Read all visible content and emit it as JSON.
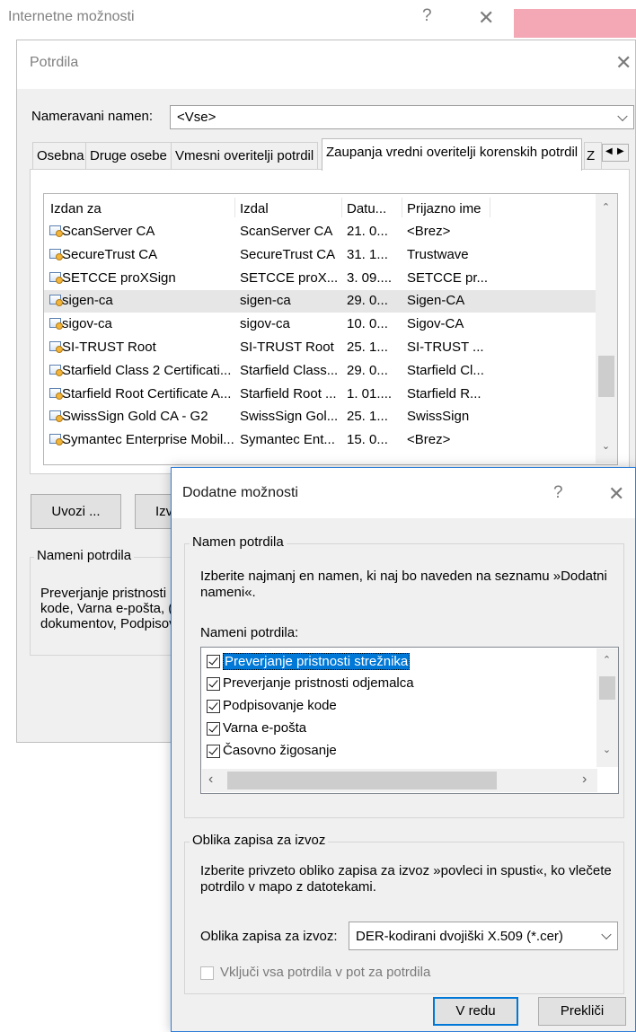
{
  "internet_options": {
    "title": "Internetne možnosti",
    "help": "?",
    "close": "✕"
  },
  "certificates": {
    "title": "Potrdila",
    "close": "✕",
    "intended_purpose_label": "Nameravani namen:",
    "intended_purpose_value": "<Vse>",
    "tabs": [
      {
        "label": "Osebna"
      },
      {
        "label": "Druge osebe"
      },
      {
        "label": "Vmesni overitelji potrdil"
      },
      {
        "label": "Zaupanja vredni overitelji korenskih potrdil"
      },
      {
        "label": "Z"
      }
    ],
    "columns": {
      "issued_to": "Izdan za",
      "issued_by": "Izdal",
      "expiration": "Datu...",
      "friendly_name": "Prijazno ime"
    },
    "rows": [
      {
        "issued_to": "ScanServer CA",
        "issued_by": "ScanServer CA",
        "expiration": "21. 0...",
        "friendly_name": "<Brez>"
      },
      {
        "issued_to": "SecureTrust CA",
        "issued_by": "SecureTrust CA",
        "expiration": "31. 1...",
        "friendly_name": "Trustwave"
      },
      {
        "issued_to": "SETCCE proXSign",
        "issued_by": "SETCCE proX...",
        "expiration": "3. 09....",
        "friendly_name": "SETCCE pr..."
      },
      {
        "issued_to": "sigen-ca",
        "issued_by": "sigen-ca",
        "expiration": "29. 0...",
        "friendly_name": "Sigen-CA"
      },
      {
        "issued_to": "sigov-ca",
        "issued_by": "sigov-ca",
        "expiration": "10. 0...",
        "friendly_name": "Sigov-CA"
      },
      {
        "issued_to": "SI-TRUST Root",
        "issued_by": "SI-TRUST Root",
        "expiration": "25. 1...",
        "friendly_name": "SI-TRUST ..."
      },
      {
        "issued_to": "Starfield Class 2 Certificati...",
        "issued_by": "Starfield Class...",
        "expiration": "29. 0...",
        "friendly_name": "Starfield Cl..."
      },
      {
        "issued_to": "Starfield Root Certificate A...",
        "issued_by": "Starfield Root ...",
        "expiration": "1. 01....",
        "friendly_name": "Starfield R..."
      },
      {
        "issued_to": "SwissSign Gold CA - G2",
        "issued_by": "SwissSign Gol...",
        "expiration": "25. 1...",
        "friendly_name": "SwissSign"
      },
      {
        "issued_to": "Symantec Enterprise Mobil...",
        "issued_by": "Symantec Ent...",
        "expiration": "15. 0...",
        "friendly_name": "<Brez>"
      }
    ],
    "selected_row": "sigen-ca",
    "import_button": "Uvozi ...",
    "export_button_partial": "Izv",
    "purposes_group_label": "Nameni potrdila",
    "purposes_text_lines": [
      "Preverjanje pristnosti",
      "kode, Varna e-pošta, (",
      "dokumentov, Podpisov"
    ]
  },
  "advanced_dialog": {
    "title": "Dodatne možnosti",
    "help": "?",
    "close": "✕",
    "purpose_group_label": "Namen potrdila",
    "purpose_description": "Izberite najmanj en namen, ki naj bo naveden na seznamu »Dodatni nameni«.",
    "purposes_list_label": "Nameni potrdila:",
    "purposes": [
      {
        "label": "Preverjanje pristnosti strežnika",
        "checked": true
      },
      {
        "label": "Preverjanje pristnosti odjemalca",
        "checked": true
      },
      {
        "label": "Podpisovanje kode",
        "checked": true
      },
      {
        "label": "Varna e-pošta",
        "checked": true
      },
      {
        "label": "Časovno žigosanje",
        "checked": true
      }
    ],
    "export_group_label": "Oblika zapisa za izvoz",
    "export_description": "Izberite privzeto obliko zapisa za izvoz »povleci in spusti«, ko vlečete potrdilo v mapo z datotekami.",
    "export_format_label": "Oblika zapisa za izvoz:",
    "export_format_value": "DER-kodirani dvojiški X.509 (*.cer)",
    "include_all_label": "Vključi vsa potrdila v pot za potrdila",
    "include_all_checked": false,
    "ok_button": "V redu",
    "cancel_button": "Prekliči"
  }
}
